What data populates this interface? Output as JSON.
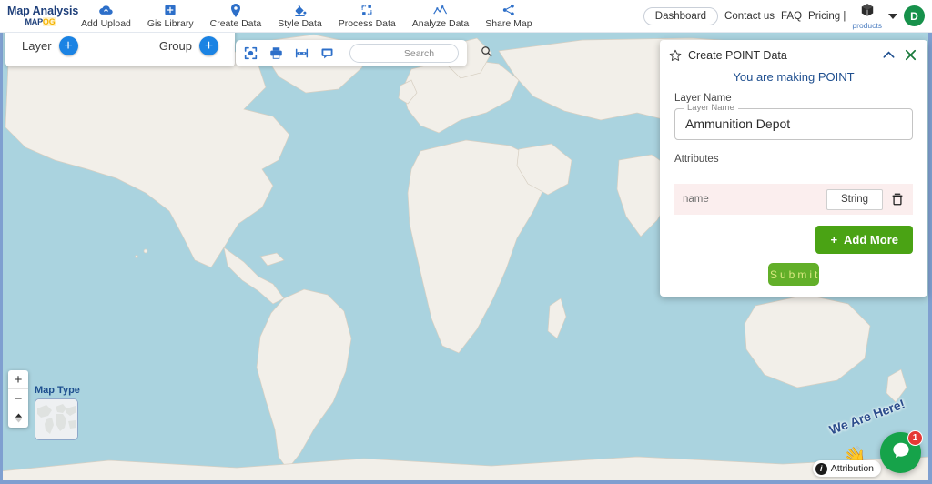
{
  "navbar": {
    "brand_title": "Map Analysis",
    "brand_sub_main": "MAP",
    "brand_sub_accent": "OG",
    "items": [
      {
        "label": "Add Upload",
        "icon": "cloud-upload-icon"
      },
      {
        "label": "Gis Library",
        "icon": "library-add-icon"
      },
      {
        "label": "Create Data",
        "icon": "map-pin-icon"
      },
      {
        "label": "Style Data",
        "icon": "paint-bucket-icon"
      },
      {
        "label": "Process Data",
        "icon": "process-nodes-icon"
      },
      {
        "label": "Analyze Data",
        "icon": "analytics-icon"
      },
      {
        "label": "Share Map",
        "icon": "share-icon"
      }
    ],
    "dashboard_label": "Dashboard",
    "contact_label": "Contact us",
    "faq_label": "FAQ",
    "pricing_label": "Pricing |",
    "products_label": "products",
    "avatar_initial": "D"
  },
  "layer_panel": {
    "layer_label": "Layer",
    "layer_add_glyph": "+",
    "group_label": "Group",
    "group_add_glyph": "+"
  },
  "map_toolbar": {
    "icons": [
      "locate-crosshair-icon",
      "print-icon",
      "measure-icon",
      "comment-icon"
    ],
    "search_placeholder": "Search",
    "search_value": ""
  },
  "create_panel": {
    "title": "Create POINT Data",
    "star_icon": "star-outline-icon",
    "collapse_icon": "chevron-up-icon",
    "close_icon": "close-icon",
    "subtitle": "You are making POINT",
    "layer_name_section_label": "Layer Name",
    "layer_name_field_label": "Layer Name",
    "layer_name_value": "Ammunition Depot",
    "attributes_label": "Attributes",
    "attributes": [
      {
        "name": "name",
        "type": "String",
        "delete_icon": "trash-icon"
      }
    ],
    "add_more_label": "Add More",
    "add_more_glyph": "+",
    "submit_label": "Submit"
  },
  "map_controls": {
    "zoom_in_glyph": "+",
    "zoom_out_glyph": "−",
    "compass_glyph": "▲",
    "map_type_label": "Map Type",
    "attribution_label": "Attribution",
    "attribution_glyph": "i"
  },
  "chat_widget": {
    "promo_text": "We Are Here!",
    "badge_count": "1",
    "icon": "chat-bubble-icon"
  },
  "colors": {
    "water": "#aad3df",
    "land": "#f2efe9",
    "brand_blue": "#1e3f7a",
    "accent_blue": "#1b83e3",
    "green": "#4aa314",
    "avatar_green": "#17914b",
    "attr_row_pink": "#fbeeee"
  }
}
